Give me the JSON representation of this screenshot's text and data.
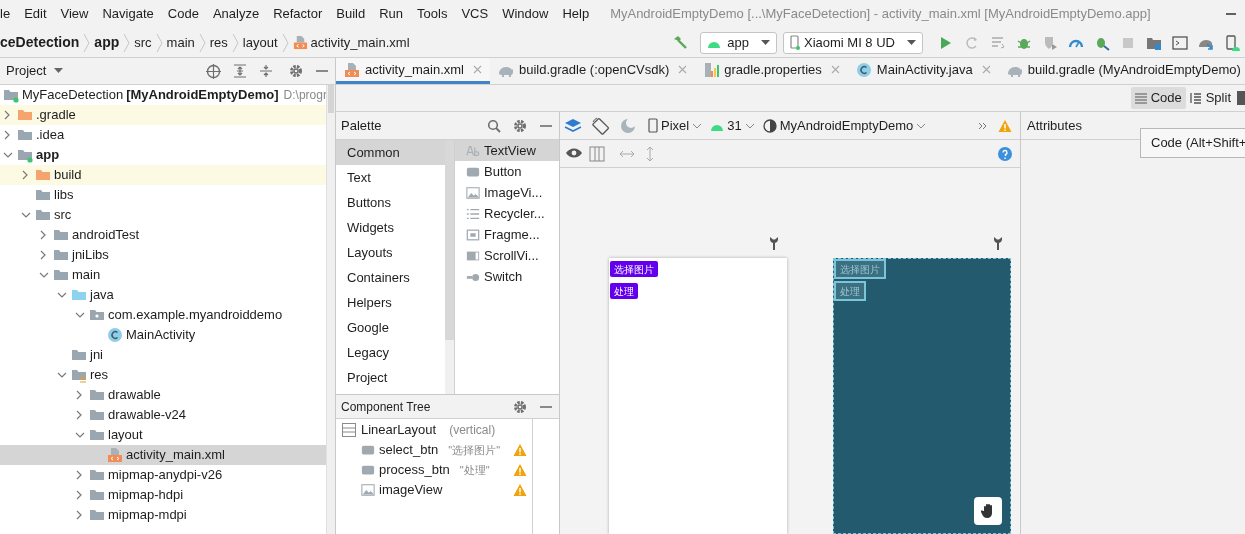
{
  "menu": [
    "le",
    "Edit",
    "View",
    "Navigate",
    "Code",
    "Analyze",
    "Refactor",
    "Build",
    "Run",
    "Tools",
    "VCS",
    "Window",
    "Help"
  ],
  "window": {
    "title": "MyAndroidEmptyDemo [...\\MyFaceDetection] - activity_main.xml [MyAndroidEmptyDemo.app]"
  },
  "breadcrumbs": [
    {
      "label": "ceDetection",
      "kind": "module"
    },
    {
      "label": "app",
      "kind": "module"
    },
    {
      "label": "src",
      "kind": "folder"
    },
    {
      "label": "main",
      "kind": "folder"
    },
    {
      "label": "res",
      "kind": "folder"
    },
    {
      "label": "layout",
      "kind": "folder"
    },
    {
      "label": "activity_main.xml",
      "kind": "file"
    }
  ],
  "toolbar": {
    "run_config": "app",
    "device": "Xiaomi MI 8 UD"
  },
  "project_panel": {
    "title": "Project",
    "root": {
      "name": "MyFaceDetection",
      "module": "[MyAndroidEmptyDemo]",
      "path": "D:\\progr"
    },
    "tree": [
      {
        "label": ".gradle",
        "kind": "folder-orange",
        "expanded": false,
        "highlighted": true,
        "selected": false
      },
      {
        "label": ".idea",
        "kind": "folder",
        "expanded": false,
        "highlighted": false,
        "selected": false
      },
      {
        "label": "app",
        "kind": "module",
        "expanded": true,
        "highlighted": false,
        "selected": false,
        "children": [
          {
            "label": "build",
            "kind": "folder-orange",
            "expanded": false,
            "highlighted": true,
            "selected": false
          },
          {
            "label": "libs",
            "kind": "folder",
            "highlighted": false,
            "selected": false
          },
          {
            "label": "src",
            "kind": "folder",
            "expanded": true,
            "highlighted": false,
            "selected": false,
            "children": [
              {
                "label": "androidTest",
                "kind": "folder",
                "expanded": false,
                "highlighted": false,
                "selected": false
              },
              {
                "label": "jniLibs",
                "kind": "folder",
                "expanded": false,
                "highlighted": false,
                "selected": false
              },
              {
                "label": "main",
                "kind": "folder",
                "expanded": true,
                "highlighted": false,
                "selected": false,
                "children": [
                  {
                    "label": "java",
                    "kind": "folder-blue",
                    "expanded": true,
                    "highlighted": false,
                    "selected": false,
                    "children": [
                      {
                        "label": "com.example.myandroiddemo",
                        "kind": "package",
                        "expanded": true,
                        "highlighted": false,
                        "selected": false,
                        "children": [
                          {
                            "label": "MainActivity",
                            "kind": "class",
                            "highlighted": false,
                            "selected": false
                          }
                        ]
                      }
                    ]
                  },
                  {
                    "label": "jni",
                    "kind": "folder",
                    "highlighted": false,
                    "selected": false
                  },
                  {
                    "label": "res",
                    "kind": "res",
                    "expanded": true,
                    "highlighted": false,
                    "selected": false,
                    "children": [
                      {
                        "label": "drawable",
                        "kind": "folder",
                        "expanded": false,
                        "highlighted": false,
                        "selected": false
                      },
                      {
                        "label": "drawable-v24",
                        "kind": "folder",
                        "expanded": false,
                        "highlighted": false,
                        "selected": false
                      },
                      {
                        "label": "layout",
                        "kind": "folder",
                        "expanded": true,
                        "highlighted": false,
                        "selected": false,
                        "children": [
                          {
                            "label": "activity_main.xml",
                            "kind": "xml",
                            "highlighted": false,
                            "selected": true
                          }
                        ]
                      },
                      {
                        "label": "mipmap-anydpi-v26",
                        "kind": "folder",
                        "expanded": false,
                        "highlighted": false,
                        "selected": false
                      },
                      {
                        "label": "mipmap-hdpi",
                        "kind": "folder",
                        "expanded": false,
                        "highlighted": false,
                        "selected": false
                      },
                      {
                        "label": "mipmap-mdpi",
                        "kind": "folder",
                        "expanded": false,
                        "highlighted": false,
                        "selected": false
                      }
                    ]
                  }
                ]
              }
            ]
          }
        ]
      }
    ]
  },
  "editor_tabs": [
    {
      "label": "activity_main.xml",
      "kind": "xml",
      "selected": true
    },
    {
      "label": "build.gradle (:openCVsdk)",
      "kind": "gradle",
      "selected": false
    },
    {
      "label": "gradle.properties",
      "kind": "properties",
      "selected": false
    },
    {
      "label": "MainActivity.java",
      "kind": "class",
      "selected": false
    },
    {
      "label": "build.gradle (MyAndroidEmptyDemo)",
      "kind": "gradle",
      "selected": false
    }
  ],
  "view_modes": [
    {
      "label": "Code",
      "selected": true
    },
    {
      "label": "Split",
      "selected": false
    }
  ],
  "palette": {
    "title": "Palette",
    "categories": [
      {
        "label": "Common",
        "selected": true
      },
      {
        "label": "Text",
        "selected": false
      },
      {
        "label": "Buttons",
        "selected": false
      },
      {
        "label": "Widgets",
        "selected": false
      },
      {
        "label": "Layouts",
        "selected": false
      },
      {
        "label": "Containers",
        "selected": false
      },
      {
        "label": "Helpers",
        "selected": false
      },
      {
        "label": "Google",
        "selected": false
      },
      {
        "label": "Legacy",
        "selected": false
      },
      {
        "label": "Project",
        "selected": false
      }
    ],
    "widgets": [
      {
        "label": "TextView",
        "kind": "text",
        "selected": true
      },
      {
        "label": "Button",
        "kind": "button",
        "selected": false
      },
      {
        "label": "ImageVi...",
        "kind": "image",
        "selected": false
      },
      {
        "label": "Recycler...",
        "kind": "list",
        "selected": false
      },
      {
        "label": "Fragme...",
        "kind": "fragment",
        "selected": false
      },
      {
        "label": "ScrollVi...",
        "kind": "scroll",
        "selected": false
      },
      {
        "label": "Switch",
        "kind": "switch",
        "selected": false
      }
    ]
  },
  "component_tree": {
    "title": "Component Tree",
    "root": {
      "label": "LinearLayout",
      "detail": "(vertical)"
    },
    "children": [
      {
        "label": "select_btn",
        "detail": "\"选择图片\"",
        "kind": "button",
        "warning": true
      },
      {
        "label": "process_btn",
        "detail": "\"处理\"",
        "kind": "button",
        "warning": true
      },
      {
        "label": "imageView",
        "kind": "image",
        "warning": true
      }
    ]
  },
  "design_toolbar": {
    "device": "Pixel",
    "api": "31",
    "theme": "MyAndroidEmptyDemo"
  },
  "preview": {
    "buttons": [
      "选择图片",
      "处理"
    ],
    "blueprint_buttons": [
      "选择图片",
      "处理"
    ]
  },
  "attributes": {
    "title": "Attributes"
  },
  "tooltip": "Code (Alt+Shift+"
}
